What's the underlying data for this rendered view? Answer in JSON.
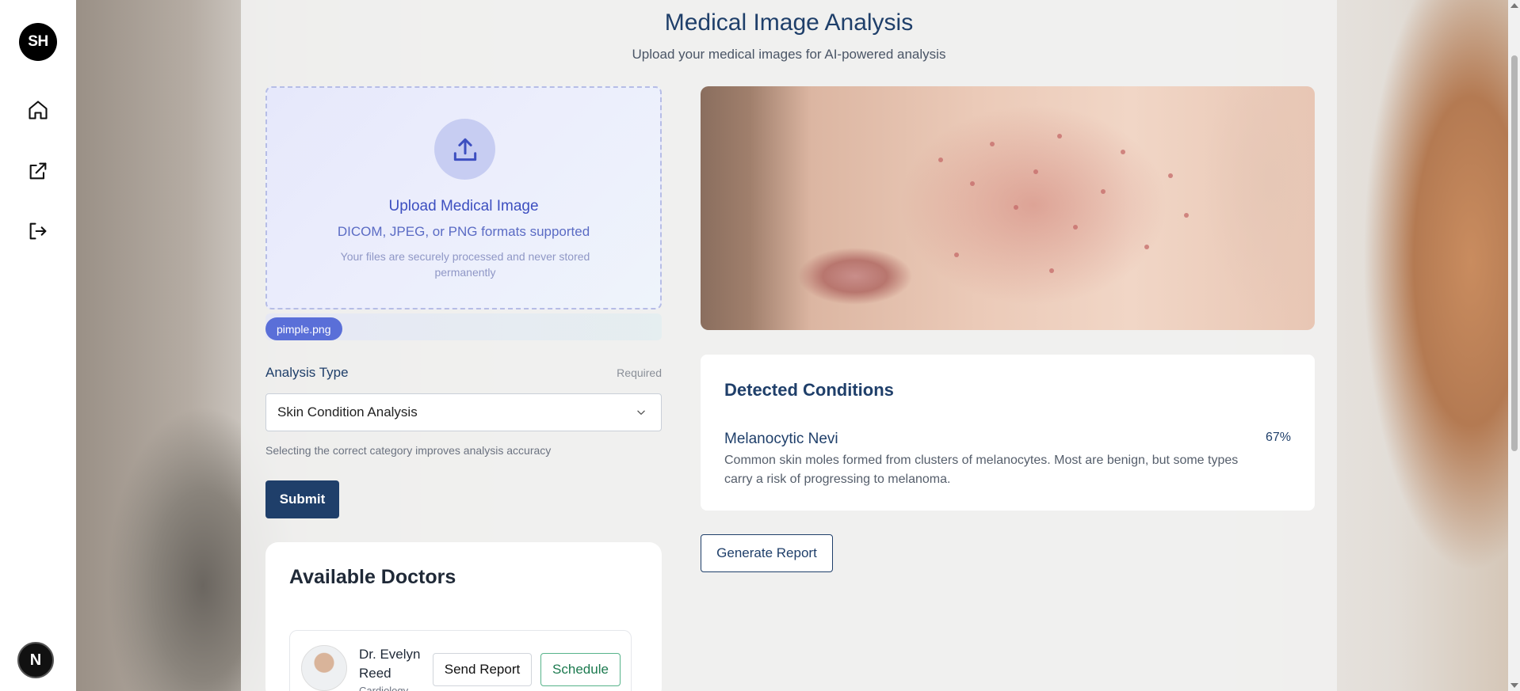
{
  "sidebar": {
    "avatar_initials": "SH",
    "items": [
      {
        "icon": "home-icon"
      },
      {
        "icon": "external-link-icon"
      },
      {
        "icon": "logout-icon"
      }
    ],
    "bottom_badge": "N"
  },
  "header": {
    "title": "Medical Image Analysis",
    "subtitle": "Upload your medical images for AI-powered analysis"
  },
  "upload": {
    "icon": "upload-icon",
    "title": "Upload Medical Image",
    "formats": "DICOM, JPEG, or PNG formats supported",
    "note": "Your files are securely processed and never stored permanently",
    "file_name": "pimple.png"
  },
  "form": {
    "analysis_label": "Analysis Type",
    "required_label": "Required",
    "selected_option": "Skin Condition Analysis",
    "hint": "Selecting the correct category improves analysis accuracy",
    "submit_label": "Submit"
  },
  "doctors": {
    "title": "Available Doctors",
    "list": [
      {
        "name": "Dr. Evelyn Reed",
        "specialty": "Cardiology",
        "send_label": "Send Report",
        "schedule_label": "Schedule"
      }
    ]
  },
  "results": {
    "title": "Detected Conditions",
    "conditions": [
      {
        "name": "Melanocytic Nevi",
        "confidence": "67%",
        "description": "Common skin moles formed from clusters of melanocytes. Most are benign, but some types carry a risk of progressing to melanoma."
      }
    ],
    "generate_label": "Generate Report"
  },
  "colors": {
    "primary": "#1f3f6a",
    "accent": "#5a6fd8",
    "success": "#1c7a4f"
  }
}
